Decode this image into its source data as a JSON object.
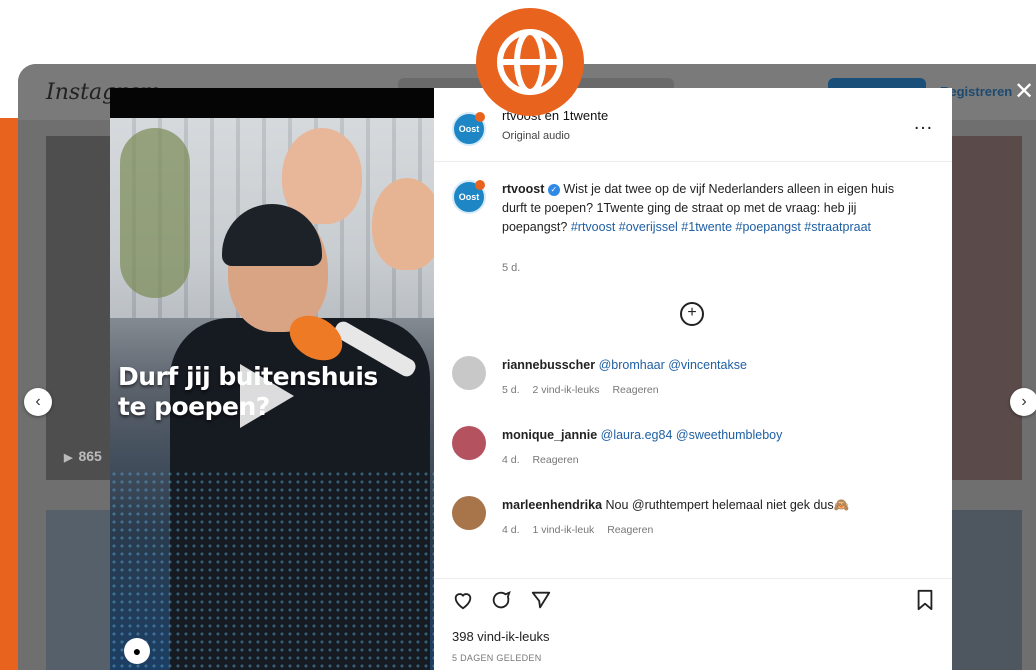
{
  "header": {
    "logo": "Instagram",
    "register_label": "Registreren",
    "close_glyph": "✕"
  },
  "grid": {
    "view_count": "865"
  },
  "nav": {
    "prev_glyph": "‹",
    "next_glyph": "›"
  },
  "video": {
    "overlay_line1": "Durf jij buitenshuis",
    "overlay_line2": "te poepen?",
    "audio_icon": "person-icon"
  },
  "post": {
    "authors": "rtvoost en 1twente",
    "audio": "Original audio",
    "avatar_label": "Oost",
    "more_glyph": "…",
    "caption_user": "rtvoost",
    "caption_text": "Wist je dat twee op de vijf Nederlanders alleen in eigen huis durft te poepen? 1Twente ging de straat op met de vraag: heb jij poepangst?",
    "caption_hashtags": "#rtvoost #overijssel #1twente #poepangst #straatpraat",
    "caption_time": "5 d.",
    "add_glyph": "+",
    "likes": "398 vind-ik-leuks",
    "date": "5 DAGEN GELEDEN"
  },
  "comments": [
    {
      "user": "riannebusscher",
      "text": "@bromhaar @vincentakse",
      "time": "5 d.",
      "likes": "2 vind-ik-leuks",
      "reply": "Reageren"
    },
    {
      "user": "monique_jannie",
      "text": "@laura.eg84 @sweethumbleboy",
      "time": "4 d.",
      "likes": "",
      "reply": "Reageren"
    },
    {
      "user": "marleenhendrika",
      "text": "Nou @ruthtempert helemaal niet gek dus🙈",
      "time": "4 d.",
      "likes": "1 vind-ik-leuk",
      "reply": "Reageren"
    }
  ],
  "colors": {
    "accent": "#e8641e",
    "mention": "#1f5fa3",
    "verified": "#2f8ae6"
  }
}
